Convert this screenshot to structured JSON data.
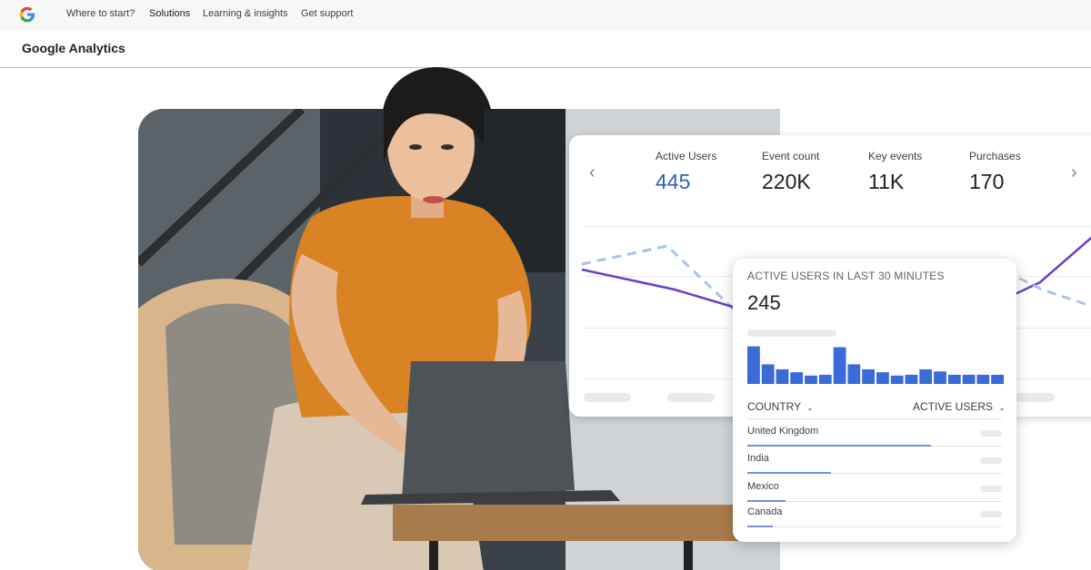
{
  "nav": {
    "logo": "google-g-logo",
    "links": [
      "Where to start?",
      "Solutions",
      "Learning & insights",
      "Get support"
    ],
    "active": "Solutions"
  },
  "product": {
    "title": "Google Analytics"
  },
  "stats_card": {
    "metrics": [
      {
        "label": "Active Users",
        "value": "445"
      },
      {
        "label": "Event count",
        "value": "220K"
      },
      {
        "label": "Key events",
        "value": "11K"
      },
      {
        "label": "Purchases",
        "value": "170"
      }
    ],
    "prev_icon": "chevron-left-icon",
    "next_icon": "chevron-right-icon",
    "colors": {
      "highlight_value": "#2f5fb8",
      "series_solid": "#6a3fc8",
      "series_dashed": "#a9c3e8"
    }
  },
  "realtime": {
    "title": "ACTIVE USERS IN LAST 30 MINUTES",
    "value": "245",
    "bar_color": "#3a6bd6",
    "bar_levels": [
      0.9,
      0.47,
      0.35,
      0.28,
      0.2,
      0.22,
      0.88,
      0.47,
      0.35,
      0.28,
      0.2,
      0.22,
      0.35,
      0.3,
      0.22,
      0.22,
      0.22,
      0.22
    ],
    "country_header": "COUNTRY",
    "users_header": "ACTIVE USERS",
    "countries": [
      {
        "name": "United Kingdom",
        "share": 0.72
      },
      {
        "name": "India",
        "share": 0.33
      },
      {
        "name": "Mexico",
        "share": 0.15
      },
      {
        "name": "Canada",
        "share": 0.1
      }
    ]
  }
}
